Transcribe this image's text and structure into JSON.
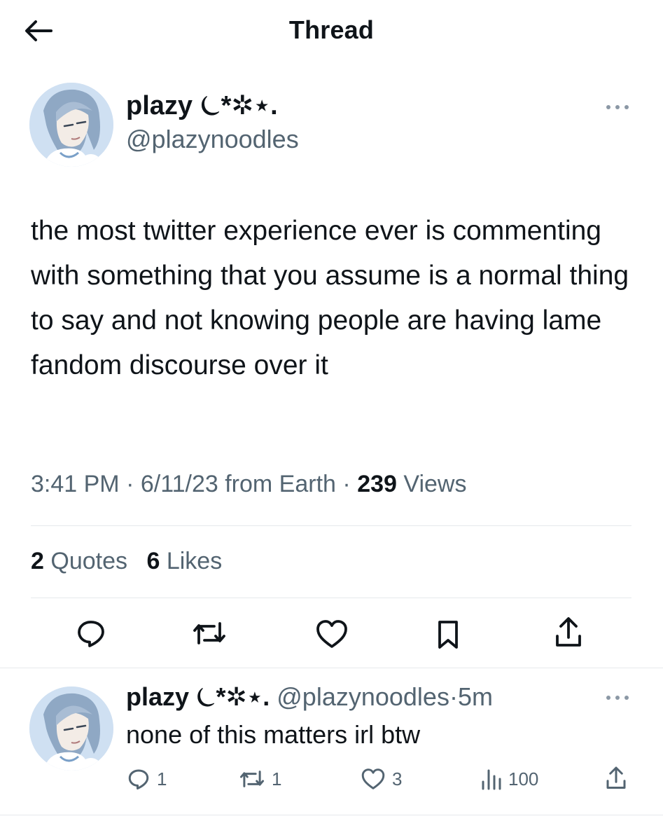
{
  "header": {
    "title": "Thread",
    "back_icon": "arrow-left-icon"
  },
  "tweet": {
    "name": "plazy ⏾*✲⋆.",
    "handle": "@plazynoodles",
    "text": "the most twitter experience ever is commenting with something that you assume is a normal thing to say and not knowing people are having lame fandom discourse over it",
    "time": "3:41 PM",
    "date": "6/11/23",
    "source": "from Earth",
    "sep": "·",
    "views_count": "239",
    "views_label": "Views",
    "quotes_count": "2",
    "quotes_label": "Quotes",
    "likes_count": "6",
    "likes_label": "Likes"
  },
  "actions": [
    "reply-icon",
    "retweet-icon",
    "heart-icon",
    "bookmark-icon",
    "share-icon"
  ],
  "reply": {
    "name": "plazy ⏾*✲⋆.",
    "handle": "@plazynoodles",
    "sep": "·",
    "time": "5m",
    "text": "none of this matters irl btw",
    "replies": "1",
    "retweets": "1",
    "likes": "3",
    "views": "100"
  },
  "colors": {
    "text": "#0f1419",
    "secondary": "#536471",
    "divider": "#e6e9ec"
  }
}
